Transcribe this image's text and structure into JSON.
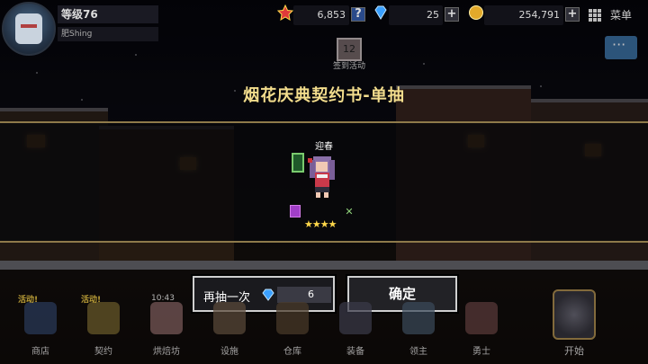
{
  "player": {
    "level": "等级76",
    "name": "肥Shing"
  },
  "resources": {
    "stars": "6,853",
    "gems": "25",
    "gold": "254,791"
  },
  "menu_label": "菜单",
  "event": {
    "day": "12",
    "label": "签到活动"
  },
  "banner": {
    "title": "烟花庆典契约书-单抽",
    "character_name": "迎春",
    "stars": "★★★★"
  },
  "actions": {
    "again_label": "再抽一次",
    "again_cost": "6",
    "confirm_label": "确定"
  },
  "nav": {
    "timer": "10:43",
    "items": [
      {
        "label": "商店",
        "badge": "活动!"
      },
      {
        "label": "契约",
        "badge": "活动!"
      },
      {
        "label": "烘焙坊",
        "badge": ""
      },
      {
        "label": "设施",
        "badge": ""
      },
      {
        "label": "仓库",
        "badge": ""
      },
      {
        "label": "装备",
        "badge": ""
      },
      {
        "label": "领主",
        "badge": ""
      },
      {
        "label": "勇士",
        "badge": ""
      }
    ],
    "start_label": "开始"
  },
  "colors": {
    "title": "#f3dd8d",
    "banner_border": "#8e7a4a",
    "star": "#ffd84a",
    "gem": "#3aa0ff"
  }
}
